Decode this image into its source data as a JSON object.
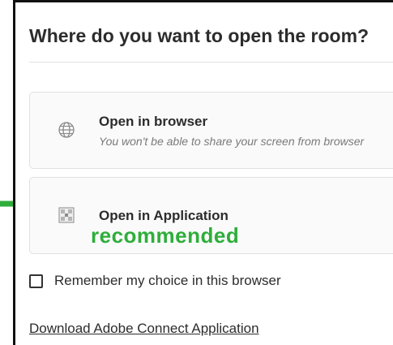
{
  "dialog": {
    "title": "Where do you want to open the room?",
    "options": [
      {
        "label": "Open in browser",
        "subtitle": "You won't be able to share your screen from browser",
        "icon": "globe-icon"
      },
      {
        "label": "Open in Application",
        "annotation": "recommended",
        "icon": "application-icon"
      }
    ],
    "remember_label": "Remember my choice in this browser",
    "remember_checked": false,
    "download_link": "Download Adobe Connect Application"
  },
  "colors": {
    "annotation_green": "#2eae3a",
    "text": "#2c2c2c",
    "subtitle": "#7a7a7a",
    "option_border": "#e1e1e1"
  }
}
